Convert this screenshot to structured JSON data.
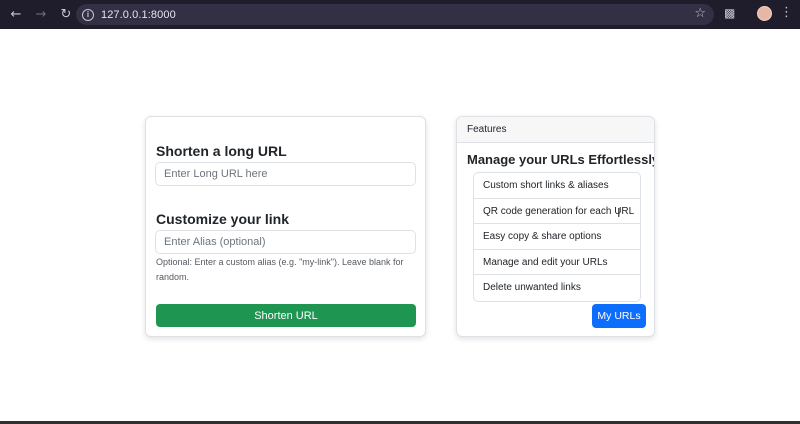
{
  "browser": {
    "url": "127.0.0.1:8000",
    "back_icon": "arrow-left-icon",
    "forward_icon": "arrow-right-icon",
    "reload_icon": "reload-icon",
    "site_info_icon": "info-icon",
    "bookmark_icon": "star-icon",
    "extensions_icon": "puzzle-icon",
    "menu_icon": "kebab-menu-icon"
  },
  "shorten_card": {
    "url_heading": "Shorten a long URL",
    "url_placeholder": "Enter Long URL here",
    "alias_heading": "Customize your link",
    "alias_placeholder": "Enter Alias (optional)",
    "alias_help": "Optional: Enter a custom alias (e.g. \"my-link\"). Leave blank for random.",
    "submit_label": "Shorten URL",
    "submit_color": "#1e9652"
  },
  "features_card": {
    "header": "Features",
    "title": "Manage your URLs Effortlessly",
    "items": [
      "Custom short links & aliases",
      "QR code generation for each URL",
      "Easy copy & share options",
      "Manage and edit your URLs",
      "Delete unwanted links"
    ],
    "button_label": "My URLs",
    "button_color": "#0d6efd"
  }
}
